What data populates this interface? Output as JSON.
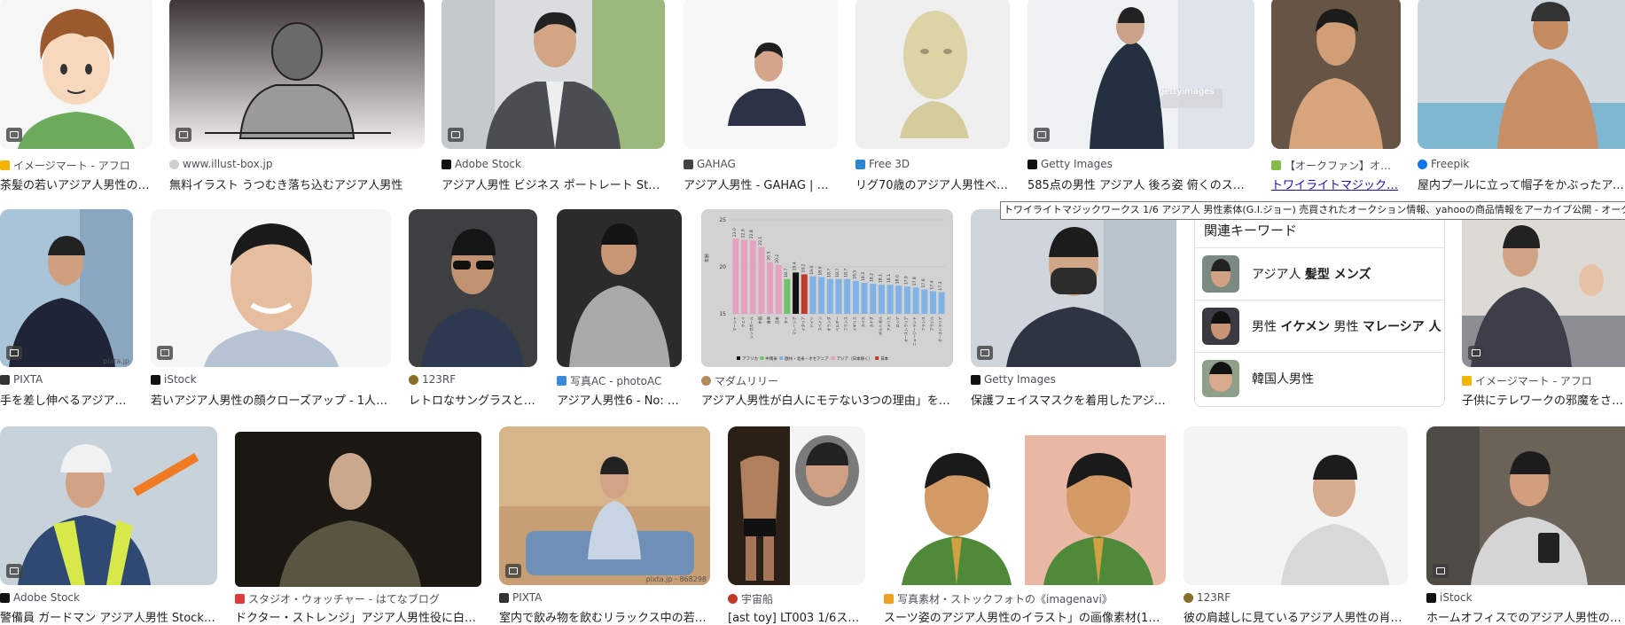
{
  "tooltip": "トワイライトマジックワークス 1/6 アジア人 男性素体(G.I.ジョー)  売買されたオークション情報、yahooの商品情報をアーカイブ公開 - オークファン (auc",
  "row1": [
    {
      "source": "イメージマート - アフロ",
      "title": "茶髪の若いアジア人男性の顔…"
    },
    {
      "source": "www.illust-box.jp",
      "title": "無料イラスト うつむき落ち込むアジア人男性"
    },
    {
      "source": "Adobe Stock",
      "title": "アジア人男性 ビジネス ポートレート Stock…"
    },
    {
      "source": "GAHAG",
      "title": "アジア人男性 - GAHAG | 著…"
    },
    {
      "source": "Free 3D",
      "title": "リグ70歳のアジア人男性べ…"
    },
    {
      "source": "Getty Images",
      "title": "585点の男性 アジア人 後ろ姿 俯くのストッ…"
    },
    {
      "source": "【オークファン】オ…",
      "title": "トワイライトマジック…"
    },
    {
      "source": "Freepik",
      "title": "屋内プールに立って帽子をかぶったアジア…"
    }
  ],
  "row2": [
    {
      "source": "PIXTA",
      "title": "手を差し伸べるアジア人…"
    },
    {
      "source": "iStock",
      "title": "若いアジア人男性の顔クローズアップ - 1人の…"
    },
    {
      "source": "123RF",
      "title": "レトロなサングラスと…"
    },
    {
      "source": "写真AC - photoAC",
      "title": "アジア人男性6 - No: 23…"
    },
    {
      "source": "マダムリリー",
      "title": "アジア人男性が白人にモテない3つの理由」を説…"
    },
    {
      "source": "Getty Images",
      "title": "保護フェイスマスクを着用したアジア…"
    },
    {
      "source": "イメージマート - アフロ",
      "title": "子供にテレワークの邪魔をされる"
    }
  ],
  "row3": [
    {
      "source": "Adobe Stock",
      "title": "警備員 ガードマン アジア人男性 Stock 写…"
    },
    {
      "source": "スタジオ・ウォッチャー - はてなブログ",
      "title": "ドクター・ストレンジ」アジア人男性役に白人…"
    },
    {
      "source": "PIXTA",
      "title": "室内で飲み物を飲むリラックス中の若い…"
    },
    {
      "source": "宇宙船",
      "title": "[ast toy] LT003 1/6スケ…"
    },
    {
      "source": "写真素材・ストックフォトの《imagenavi》",
      "title": "スーツ姿のアジア人男性のイラスト」の画像素材(1005…"
    },
    {
      "source": "123RF",
      "title": "彼の肩越しに見ているアジア人男性の肖像…"
    },
    {
      "source": "iStock",
      "title": "ホームオフィスでのアジア人男性のvlog…"
    }
  ],
  "related": {
    "title": "関連キーワード",
    "items": [
      {
        "plain": "アジア人 ",
        "bold": "髪型 メンズ",
        "rest": ""
      },
      {
        "plain": "男性 ",
        "bold": "イケメン",
        "rest": " 男性 ",
        "bold2": "マレーシア 人"
      },
      {
        "plain": "韓国人男性",
        "bold": "",
        "rest": ""
      }
    ]
  },
  "watermarks": {
    "getty": "gettyimages",
    "pixta": "pixta.jp",
    "pixta2": "pixta.jp - 868298"
  },
  "chart_data": {
    "type": "bar",
    "title": "",
    "ylabel": "年齢",
    "ylim": [
      15,
      25
    ],
    "yticks": [
      15,
      20,
      25
    ],
    "categories": [
      "マーシャ",
      "ウェイ",
      "シンガポール",
      "中国",
      "香港",
      "日本",
      "タイ",
      "マレーシア",
      "イタリア",
      "ドイツ",
      "スペイン",
      "オランダ",
      "ベルギー",
      "フランス",
      "イギリス",
      "スイス",
      "カナダ",
      "ポルトガル",
      "アメリカ",
      "ロシア",
      "オーストラリア",
      "ニュージーランド",
      "フランス",
      "ブラジル",
      "オーストラリア"
    ],
    "values": [
      23.0,
      22.9,
      22.8,
      22.1,
      20.5,
      20.2,
      18.7,
      19.4,
      19.2,
      19.0,
      18.9,
      18.7,
      18.7,
      18.7,
      18.5,
      18.3,
      18.2,
      18.1,
      18.1,
      18.0,
      17.9,
      17.8,
      17.6,
      17.4,
      17.3
    ],
    "legend": [
      "アフリカ",
      "中南米",
      "欧州・北米・オセアニア",
      "アジア（日本除く）",
      "日本"
    ]
  }
}
